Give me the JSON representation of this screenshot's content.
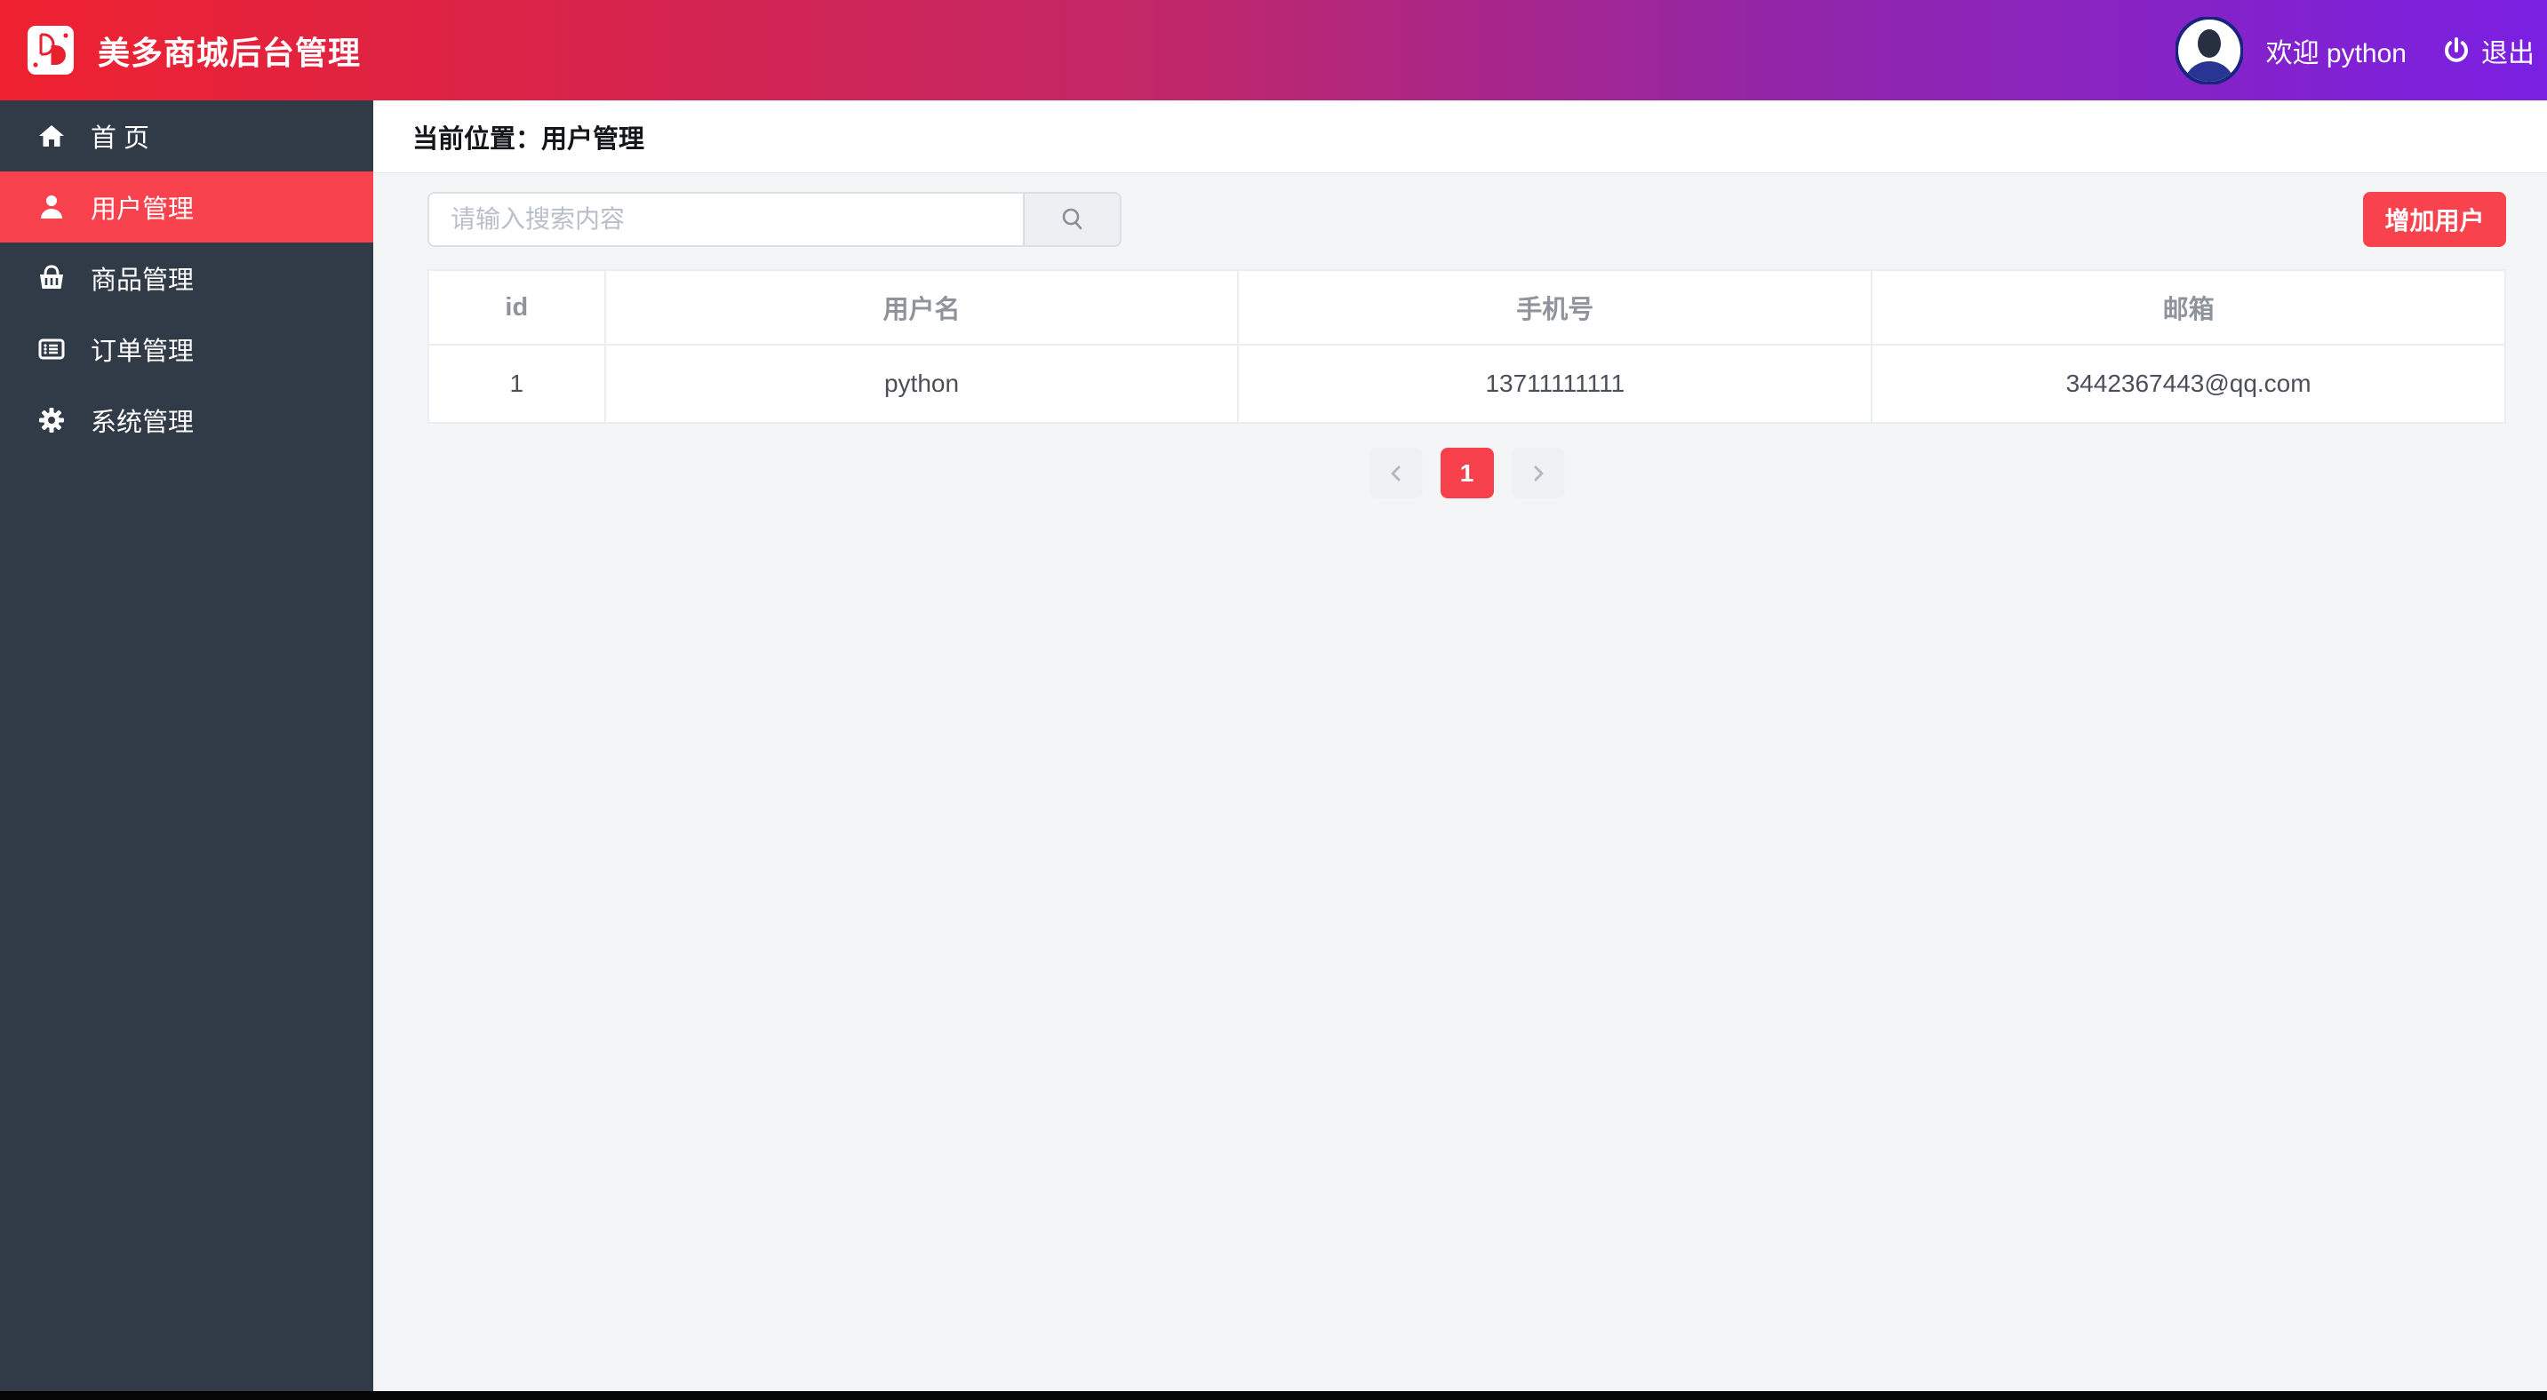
{
  "header": {
    "title": "美多商城后台管理",
    "welcome": "欢迎 python",
    "logout": "退出"
  },
  "sidebar": {
    "items": [
      {
        "label": "首 页",
        "icon": "home-icon",
        "active": false
      },
      {
        "label": "用户管理",
        "icon": "user-icon",
        "active": true
      },
      {
        "label": "商品管理",
        "icon": "basket-icon",
        "active": false
      },
      {
        "label": "订单管理",
        "icon": "order-list-icon",
        "active": false
      },
      {
        "label": "系统管理",
        "icon": "gear-icon",
        "active": false
      }
    ]
  },
  "breadcrumb": {
    "prefix": "当前位置：",
    "current": "用户管理"
  },
  "toolbar": {
    "search_placeholder": "请输入搜索内容",
    "add_user_label": "增加用户"
  },
  "table": {
    "columns": [
      "id",
      "用户名",
      "手机号",
      "邮箱"
    ],
    "rows": [
      [
        "1",
        "python",
        "13711111111",
        "3442367443@qq.com"
      ]
    ]
  },
  "pagination": {
    "current_page": "1"
  },
  "colors": {
    "topbar_gradient_left": "#ef212f",
    "topbar_gradient_right": "#7a20e2",
    "sidebar_bg": "#313b47",
    "accent_red": "#f8434e",
    "pagination_active": "#f6414d",
    "content_bg": "#f4f5f7",
    "table_border": "#eaedf3",
    "header_text_gray": "#8f949c"
  }
}
